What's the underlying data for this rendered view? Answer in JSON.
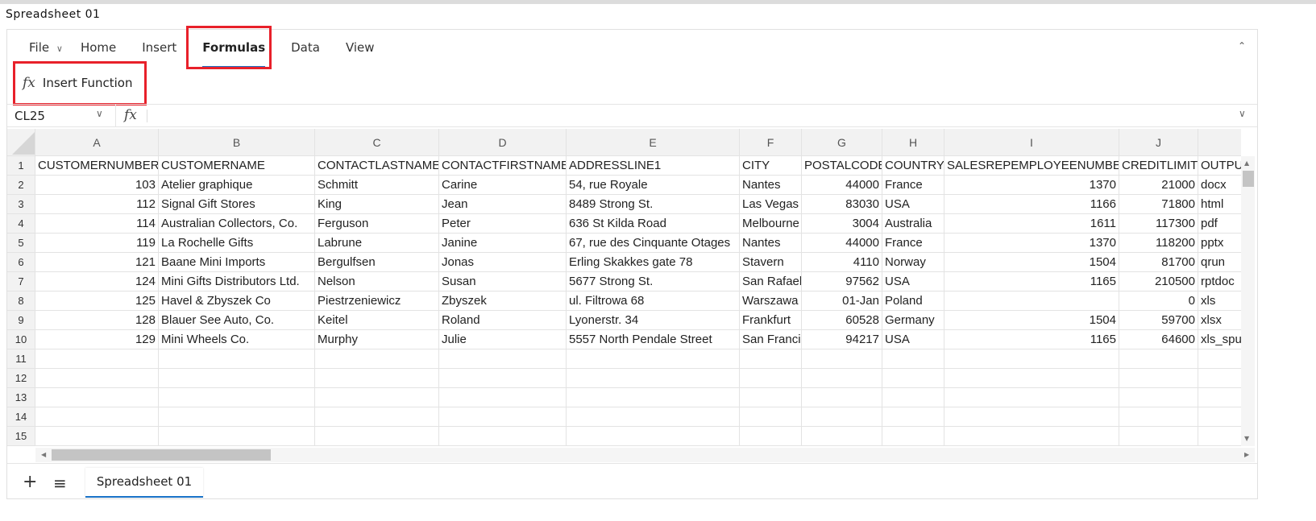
{
  "window": {
    "title": "Spreadsheet 01"
  },
  "ribbon": {
    "tabs": [
      {
        "label": "File"
      },
      {
        "label": "Home"
      },
      {
        "label": "Insert"
      },
      {
        "label": "Formulas",
        "active": true
      },
      {
        "label": "Data"
      },
      {
        "label": "View"
      }
    ],
    "insert_function_label": "Insert Function",
    "highlight_color": "#e8202a",
    "accent_color": "#1a73c8"
  },
  "formula_bar": {
    "name_box": "CL25",
    "fx_icon": "fx",
    "formula": ""
  },
  "grid": {
    "columns": [
      "A",
      "B",
      "C",
      "D",
      "E",
      "F",
      "G",
      "H",
      "I",
      "J",
      ""
    ],
    "row_numbers": [
      "1",
      "2",
      "3",
      "4",
      "5",
      "6",
      "7",
      "8",
      "9",
      "10",
      "11",
      "12",
      "13",
      "14",
      "15"
    ],
    "rows": [
      [
        "CUSTOMERNUMBER",
        "CUSTOMERNAME",
        "CONTACTLASTNAME",
        "CONTACTFIRSTNAME",
        "ADDRESSLINE1",
        "CITY",
        "POSTALCODE",
        "COUNTRY",
        "SALESREPEMPLOYEENUMBER",
        "CREDITLIMIT",
        "OUTPU"
      ],
      [
        "103",
        "Atelier graphique",
        "Schmitt",
        "Carine",
        "54, rue Royale",
        "Nantes",
        "44000",
        "France",
        "1370",
        "21000",
        "docx"
      ],
      [
        "112",
        "Signal Gift Stores",
        "King",
        "Jean",
        "8489 Strong St.",
        "Las Vegas",
        "83030",
        "USA",
        "1166",
        "71800",
        "html"
      ],
      [
        "114",
        "Australian Collectors, Co.",
        "Ferguson",
        "Peter",
        "636 St Kilda Road",
        "Melbourne",
        "3004",
        "Australia",
        "1611",
        "117300",
        "pdf"
      ],
      [
        "119",
        "La Rochelle Gifts",
        "Labrune",
        "Janine",
        "67, rue des Cinquante Otages",
        "Nantes",
        "44000",
        "France",
        "1370",
        "118200",
        "pptx"
      ],
      [
        "121",
        "Baane Mini Imports",
        "Bergulfsen",
        "Jonas",
        "Erling Skakkes gate 78",
        "Stavern",
        "4110",
        "Norway",
        "1504",
        "81700",
        "qrun"
      ],
      [
        "124",
        "Mini Gifts Distributors Ltd.",
        "Nelson",
        "Susan",
        "5677 Strong St.",
        "San Rafael",
        "97562",
        "USA",
        "1165",
        "210500",
        "rptdoc"
      ],
      [
        "125",
        "Havel & Zbyszek Co",
        "Piestrzeniewicz",
        "Zbyszek",
        "ul. Filtrowa 68",
        "Warszawa",
        "01-Jan",
        "Poland",
        "",
        "0",
        "xls"
      ],
      [
        "128",
        "Blauer See Auto, Co.",
        "Keitel",
        "Roland",
        "Lyonerstr. 34",
        "Frankfurt",
        "60528",
        "Germany",
        "1504",
        "59700",
        "xlsx"
      ],
      [
        "129",
        "Mini Wheels Co.",
        "Murphy",
        "Julie",
        "5557 North Pendale Street",
        "San Francisco",
        "94217",
        "USA",
        "1165",
        "64600",
        "xls_spu"
      ]
    ]
  },
  "sheet_tabs": {
    "add_icon": "plus-icon",
    "menu_icon": "hamburger-icon",
    "tabs": [
      "Spreadsheet 01"
    ]
  }
}
